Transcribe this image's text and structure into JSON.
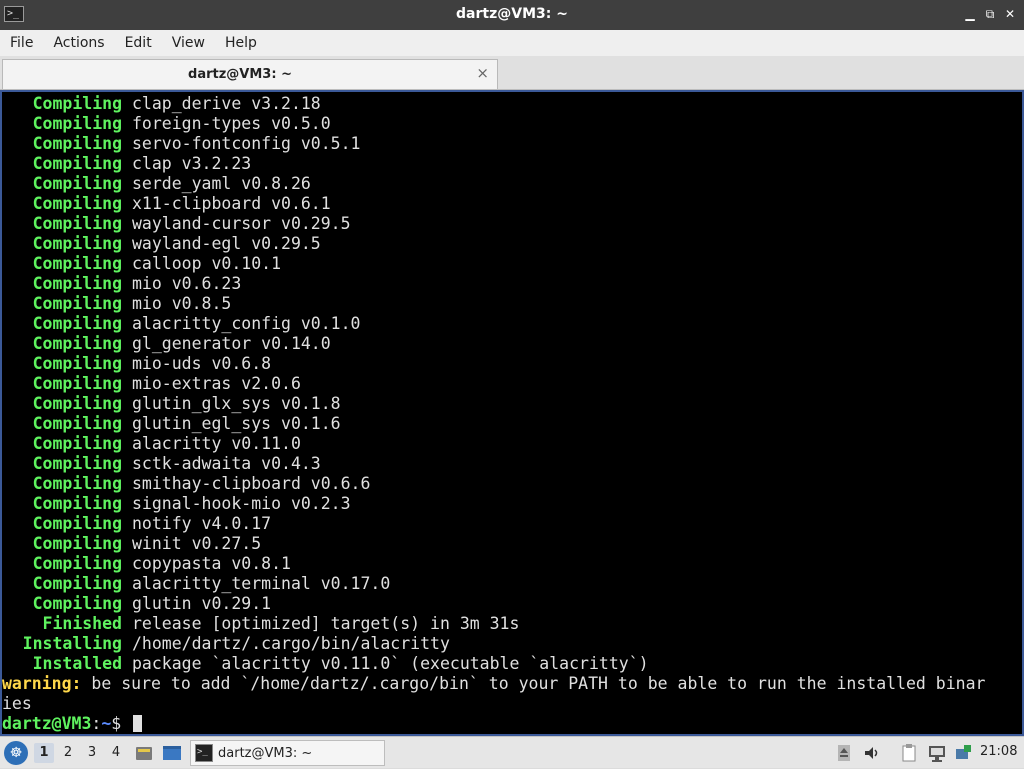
{
  "window": {
    "title": "dartz@VM3: ~",
    "min_glyph": "▁",
    "restore_glyph": "⧉",
    "close_glyph": "✕"
  },
  "menu": [
    "File",
    "Actions",
    "Edit",
    "View",
    "Help"
  ],
  "tab": {
    "title": "dartz@VM3: ~",
    "close_glyph": "×"
  },
  "terminal": {
    "compile_lines": [
      {
        "status": "Compiling",
        "text": "clap_derive v3.2.18"
      },
      {
        "status": "Compiling",
        "text": "foreign-types v0.5.0"
      },
      {
        "status": "Compiling",
        "text": "servo-fontconfig v0.5.1"
      },
      {
        "status": "Compiling",
        "text": "clap v3.2.23"
      },
      {
        "status": "Compiling",
        "text": "serde_yaml v0.8.26"
      },
      {
        "status": "Compiling",
        "text": "x11-clipboard v0.6.1"
      },
      {
        "status": "Compiling",
        "text": "wayland-cursor v0.29.5"
      },
      {
        "status": "Compiling",
        "text": "wayland-egl v0.29.5"
      },
      {
        "status": "Compiling",
        "text": "calloop v0.10.1"
      },
      {
        "status": "Compiling",
        "text": "mio v0.6.23"
      },
      {
        "status": "Compiling",
        "text": "mio v0.8.5"
      },
      {
        "status": "Compiling",
        "text": "alacritty_config v0.1.0"
      },
      {
        "status": "Compiling",
        "text": "gl_generator v0.14.0"
      },
      {
        "status": "Compiling",
        "text": "mio-uds v0.6.8"
      },
      {
        "status": "Compiling",
        "text": "mio-extras v2.0.6"
      },
      {
        "status": "Compiling",
        "text": "glutin_glx_sys v0.1.8"
      },
      {
        "status": "Compiling",
        "text": "glutin_egl_sys v0.1.6"
      },
      {
        "status": "Compiling",
        "text": "alacritty v0.11.0"
      },
      {
        "status": "Compiling",
        "text": "sctk-adwaita v0.4.3"
      },
      {
        "status": "Compiling",
        "text": "smithay-clipboard v0.6.6"
      },
      {
        "status": "Compiling",
        "text": "signal-hook-mio v0.2.3"
      },
      {
        "status": "Compiling",
        "text": "notify v4.0.17"
      },
      {
        "status": "Compiling",
        "text": "winit v0.27.5"
      },
      {
        "status": "Compiling",
        "text": "copypasta v0.8.1"
      },
      {
        "status": "Compiling",
        "text": "alacritty_terminal v0.17.0"
      },
      {
        "status": "Compiling",
        "text": "glutin v0.29.1"
      },
      {
        "status": "Finished",
        "text": "release [optimized] target(s) in 3m 31s"
      },
      {
        "status": "Installing",
        "text": "/home/dartz/.cargo/bin/alacritty"
      },
      {
        "status": "Installed",
        "text": "package `alacritty v0.11.0` (executable `alacritty`)"
      }
    ],
    "warning_label": "warning:",
    "warning_text": " be sure to add `/home/dartz/.cargo/bin` to your PATH to be able to run the installed binar",
    "warning_wrap": "ies",
    "prompt_user": "dartz@VM3",
    "prompt_sep": ":",
    "prompt_path": "~",
    "prompt_symbol": "$ "
  },
  "taskbar": {
    "start_glyph": "☸",
    "workspaces": [
      "1",
      "2",
      "3",
      "4"
    ],
    "active_workspace": "1",
    "task_title": "dartz@VM3: ~",
    "task_icon_glyph": ">_",
    "app_icon_glyph": ">_",
    "clock": "21:08"
  }
}
